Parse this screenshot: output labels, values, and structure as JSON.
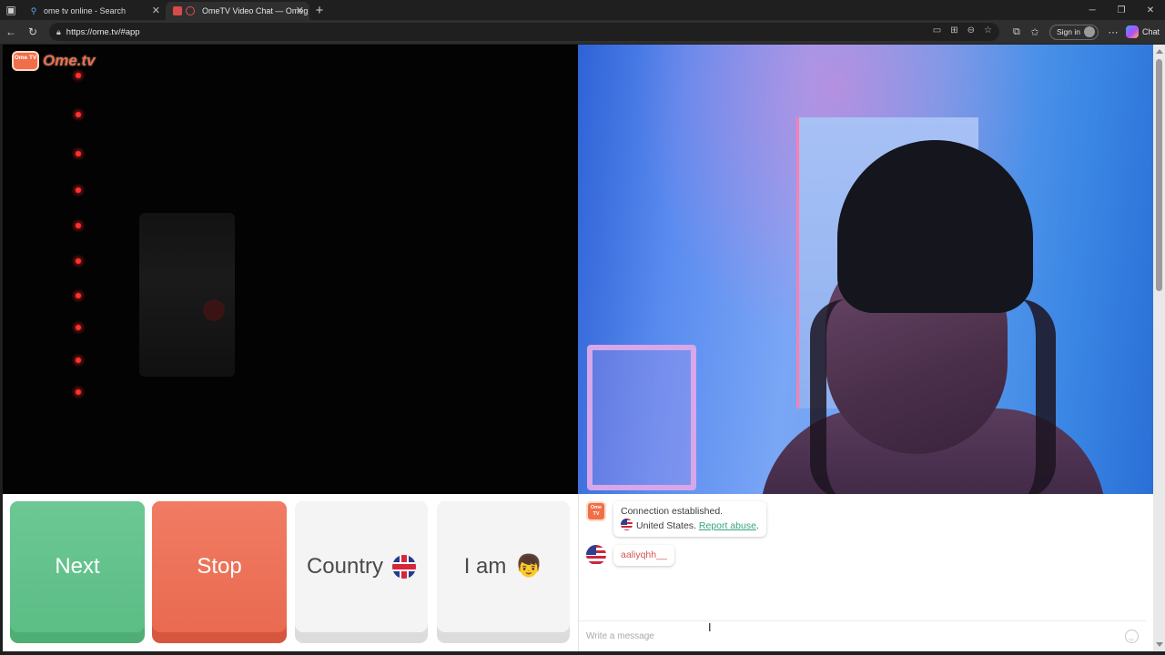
{
  "browser": {
    "tabs": [
      {
        "label": "ome tv online - Search",
        "icon": "search-icon",
        "active": false
      },
      {
        "label": "OmeTV Video Chat — Omeg",
        "icon": "ometv-favicon",
        "active": true
      }
    ],
    "url": "https://ome.tv/#app",
    "sign_in_label": "Sign in",
    "chat_label": "Chat"
  },
  "site": {
    "logo_box": "Ome TV",
    "logo_text": "Ome.tv"
  },
  "controls": {
    "next_label": "Next",
    "stop_label": "Stop",
    "country_label": "Country",
    "iam_label": "I am",
    "iam_emoji": "👦"
  },
  "chat": {
    "system_avatar": "Ome TV",
    "connection_text": "Connection established.",
    "country_text": "United States.",
    "report_text": "Report abuse",
    "report_suffix": ".",
    "username": "aaliyqhh__",
    "input_placeholder": "Write a message"
  },
  "colors": {
    "next": "#5cbd85",
    "stop": "#e96a50",
    "brand": "#f06e48",
    "link": "#36a57a"
  }
}
